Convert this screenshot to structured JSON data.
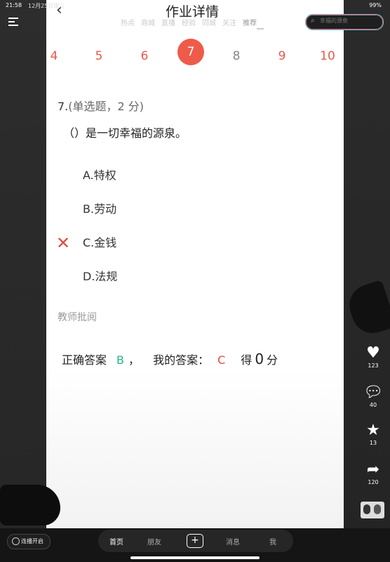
{
  "status_bar": {
    "time": "21:58",
    "date": "12月25日周三",
    "battery": "99%"
  },
  "header": {
    "title": "作业详情",
    "tabs": [
      "热点",
      "商城",
      "直播",
      "经验",
      "同城",
      "关注",
      "推荐"
    ],
    "active_tab": "推荐",
    "search_placeholder": "幸福的源泉"
  },
  "question_nav": {
    "numbers": [
      "4",
      "5",
      "6",
      "7",
      "8",
      "9",
      "10"
    ],
    "current": "7"
  },
  "question": {
    "number": "7.",
    "type": "(单选题，2 分)",
    "text": "（）是一切幸福的源泉。",
    "options": [
      "A.特权",
      "B.劳动",
      "C.金钱",
      "D.法规"
    ],
    "selected_option": "C",
    "selected_mark_color": "#e14b3d"
  },
  "review": {
    "label": "教师批阅",
    "correct_label": "正确答案",
    "correct_value": "B",
    "separator": "，",
    "my_label": "我的答案：",
    "my_value": "C",
    "score_label": "得",
    "score_value": "0",
    "score_unit": "分"
  },
  "side_actions": [
    {
      "icon": "heart-icon",
      "count": "123"
    },
    {
      "icon": "comment-icon",
      "count": "40"
    },
    {
      "icon": "star-icon",
      "count": "13"
    },
    {
      "icon": "share-icon",
      "count": "120"
    }
  ],
  "bottom_nav": {
    "live_label": "连播开启",
    "items": [
      "首页",
      "朋友",
      "消息",
      "我"
    ],
    "active": "首页"
  },
  "colors": {
    "accent": "#ef5b4b",
    "correct": "#2bb389",
    "wrong": "#e14b3d"
  }
}
